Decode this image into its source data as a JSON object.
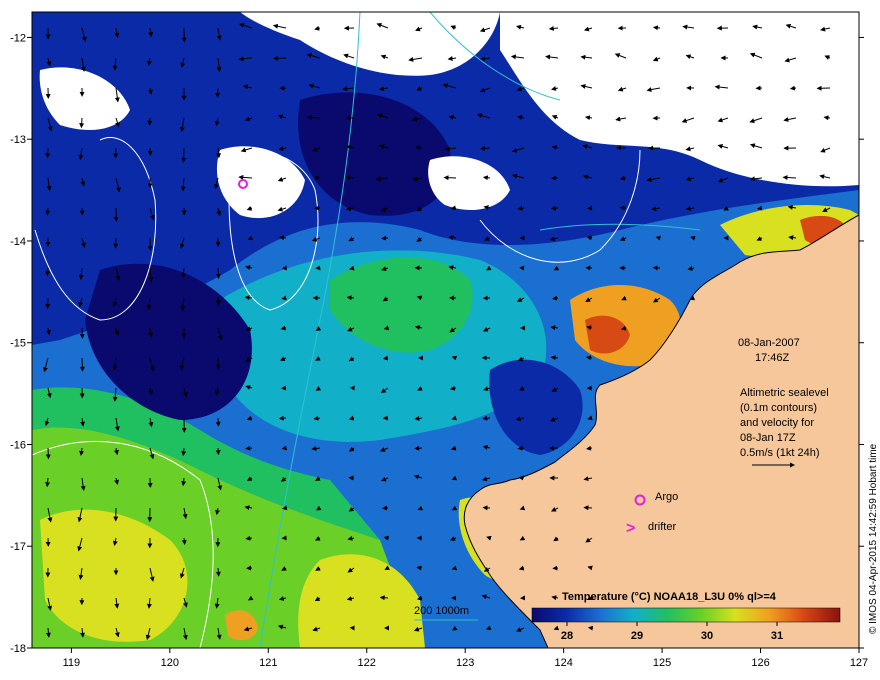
{
  "map": {
    "date": "08-Jan-2007",
    "time": "17:46Z",
    "description_lines": [
      "Altimetric sealevel",
      "(0.1m contours)",
      "and velocity for",
      "08-Jan 17Z",
      "0.5m/s (1kt 24h)"
    ],
    "argo_label": "Argo",
    "drifter_label": "drifter",
    "drifter_marker": ">",
    "credit": "© IMOS 04-Apr-2015 14:42:59 Hobart time",
    "bathymetry_label": "200  1000m",
    "lon_ticks": [
      "119",
      "120",
      "121",
      "122",
      "123",
      "124",
      "125",
      "126",
      "127"
    ],
    "lat_ticks": [
      "-12",
      "-13",
      "-14",
      "-15",
      "-16",
      "-17",
      "-18"
    ],
    "extent": {
      "lon_min": 118.6,
      "lon_max": 127,
      "lat_min": -18,
      "lat_max": -11.75
    }
  },
  "colorbar": {
    "title": "Temperature (°C) NOAA18_L3U 0% ql>=4",
    "ticks": [
      "28",
      "29",
      "30",
      "31"
    ],
    "range": [
      27.5,
      31.9
    ],
    "colors": [
      "#0a0a6e",
      "#0b2aa8",
      "#1a6fd0",
      "#12b0c8",
      "#20c060",
      "#6ad028",
      "#d8e020",
      "#f0a020",
      "#d84a14",
      "#8a1010"
    ]
  },
  "colors": {
    "land": "#f6c79a",
    "cloud": "#ffffff",
    "argo_marker": "#e020e0",
    "drifter_marker": "#e020e0",
    "bathymetry": "#30c0d0",
    "contour": "#ffffff"
  }
}
